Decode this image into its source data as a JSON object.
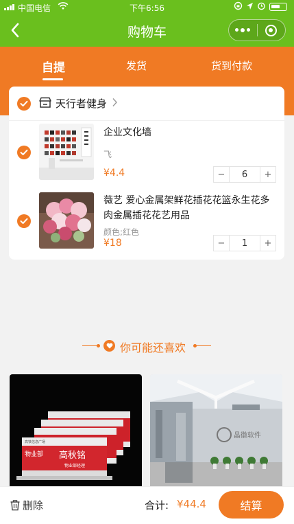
{
  "status_bar": {
    "carrier": "中国电信",
    "time": "下午6:56"
  },
  "nav": {
    "title": "购物车"
  },
  "tabs": [
    {
      "label": "自提",
      "active": true
    },
    {
      "label": "发货",
      "active": false
    },
    {
      "label": "货到付款",
      "active": false
    }
  ],
  "shop": {
    "name": "天行者健身"
  },
  "items": [
    {
      "title": "企业文化墙",
      "spec": "飞",
      "price": "¥4.4",
      "quantity": "6"
    },
    {
      "title": "薇艺 爱心金属架鲜花插花花篮永生花多肉金属插花花艺用品",
      "spec": "颜色;红色",
      "price": "¥18",
      "quantity": "1"
    }
  ],
  "stepper": {
    "minus": "−",
    "plus": "+"
  },
  "recommend": {
    "label": "你可能还喜欢"
  },
  "rec_cards": [
    {
      "plaque_company": "高铁信息广场",
      "plaque_dept": "物业部",
      "plaque_name": "高秋铭",
      "plaque_role": "物业部经理"
    },
    {
      "logo_text": "晶徽软件"
    }
  ],
  "bottom": {
    "delete_label": "删除",
    "total_label": "合计:",
    "total_value": "¥44.4",
    "checkout_label": "结算"
  },
  "colors": {
    "green": "#6abf1e",
    "orange": "#f07a24"
  }
}
